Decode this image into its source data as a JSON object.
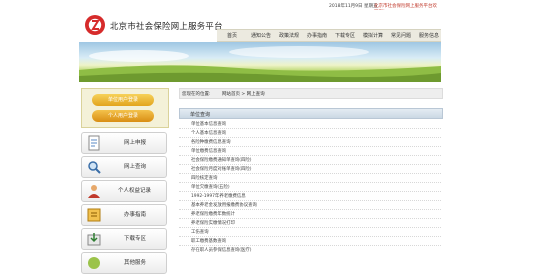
{
  "topbar": {
    "date": "2018年11月9日 星期五",
    "welcome": "北京市社会保险网上服务平台欢迎您!"
  },
  "header": {
    "site_title": "北京市社会保险网上服务平台"
  },
  "nav": {
    "items": [
      "首页",
      "通知公告",
      "政策法规",
      "办事指南",
      "下载专区",
      "模拟计算",
      "常见问题",
      "服务信息"
    ]
  },
  "sidebar": {
    "quick_buttons": [
      "单位用户登录",
      "个人用户登录"
    ],
    "menu_items": [
      {
        "label": "网上申报",
        "icon": "document-icon"
      },
      {
        "label": "网上查询",
        "icon": "magnifier-icon"
      },
      {
        "label": "个人权益记录",
        "icon": "user-record-icon"
      },
      {
        "label": "办事指南",
        "icon": "guide-book-icon"
      },
      {
        "label": "下载专区",
        "icon": "download-icon"
      },
      {
        "label": "其他服务",
        "icon": "service-icon"
      }
    ]
  },
  "breadcrumb": {
    "prefix": "您现在的位置:",
    "path": "网站首页 > 网上查询"
  },
  "panel": {
    "title": "单位查询"
  },
  "queries": [
    "单位基本信息查询",
    "个人基本信息查询",
    "各险种缴费信息查询",
    "单位缴费信息查询",
    "社会保险缴费通知单查询(四险)",
    "社会保险月度对账单查询(四险)",
    "四险核定查询",
    "单位欠缴查询(五险)",
    "1992-1997年养老缴费信息",
    "基本养老金发放用报缴费协议查询",
    "养老保险缴费年数统计",
    "养老保险实缴情况打印",
    "工伤查询",
    "职工缴费基数查询",
    "存在职人员参保信息查询(医疗)"
  ],
  "colors": {
    "accent": "#c0392b",
    "nav_bg": "#eceae0",
    "quick_bg": "#f4f1d8"
  }
}
